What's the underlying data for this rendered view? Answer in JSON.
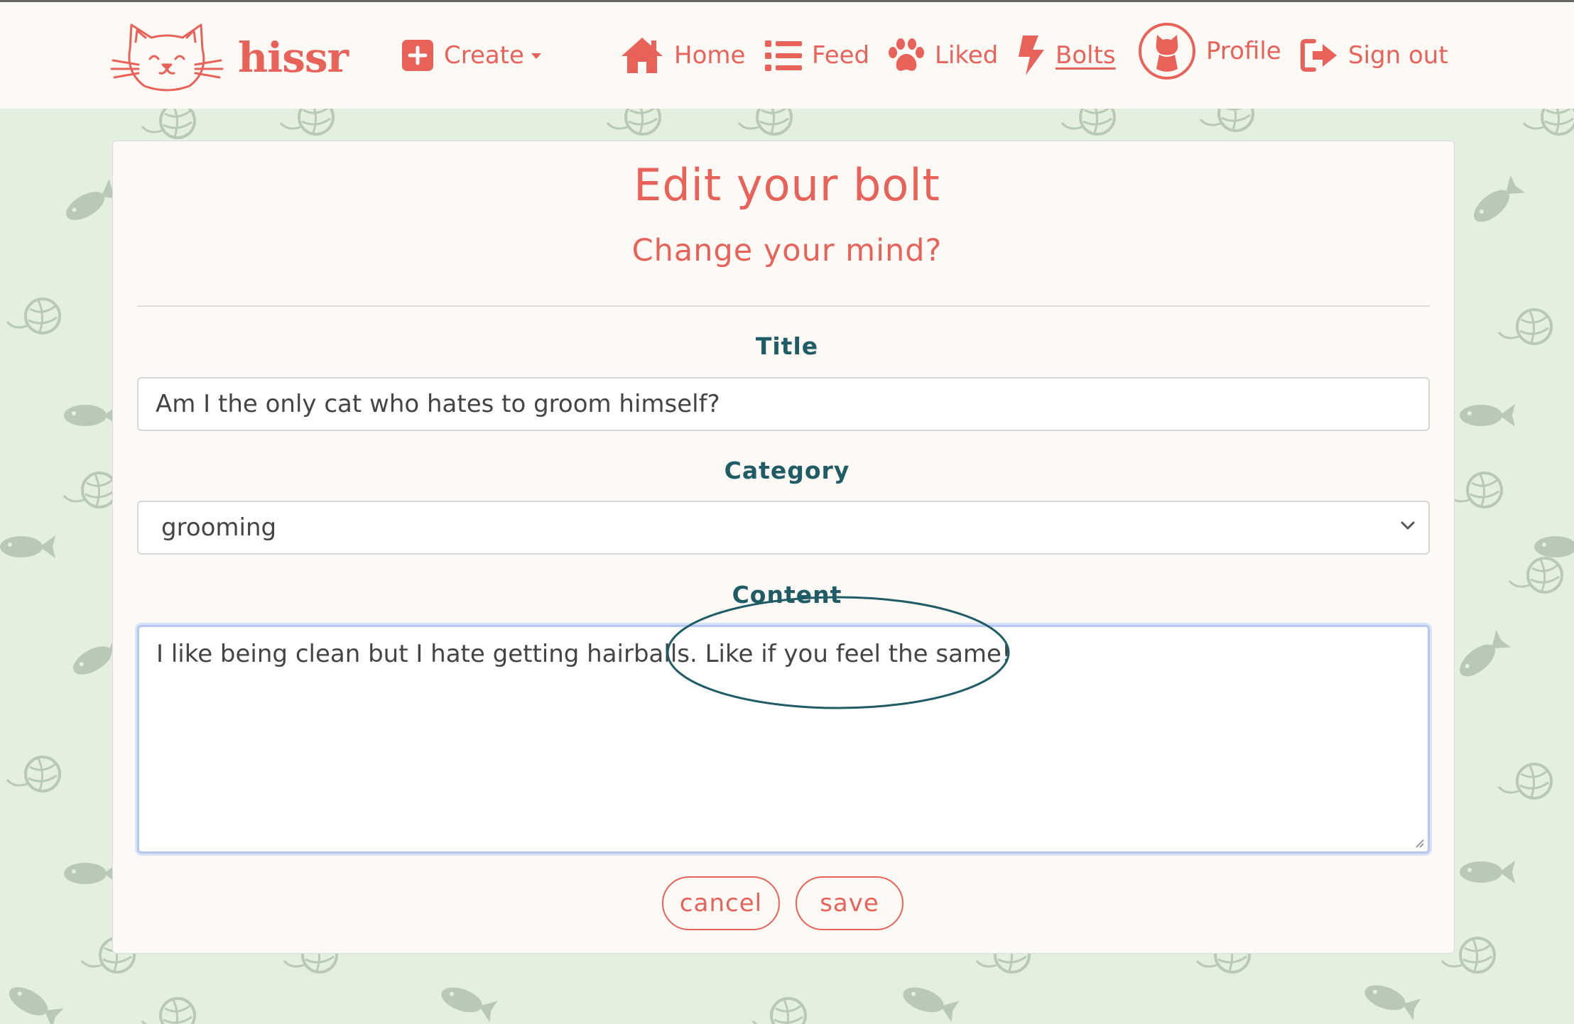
{
  "brand": {
    "name": "hissr"
  },
  "nav": {
    "create_label": "Create",
    "home_label": "Home",
    "feed_label": "Feed",
    "liked_label": "Liked",
    "bolts_label": "Bolts",
    "profile_label": "Profile",
    "signout_label": "Sign out"
  },
  "form": {
    "title": "Edit your bolt",
    "subtitle": "Change your mind?",
    "title_field": {
      "label": "Title",
      "value": "Am I the only cat who hates to groom himself?"
    },
    "category_field": {
      "label": "Category",
      "value": "grooming"
    },
    "content_field": {
      "label": "Content",
      "value": "I like being clean but I hate getting hairballs. Like if you feel the same!"
    },
    "cancel_label": "cancel",
    "save_label": "save"
  },
  "colors": {
    "accent": "#e8625a",
    "label_teal": "#1f5c66",
    "page_bg": "#e4f0df",
    "card_bg": "#fdfaf5"
  }
}
